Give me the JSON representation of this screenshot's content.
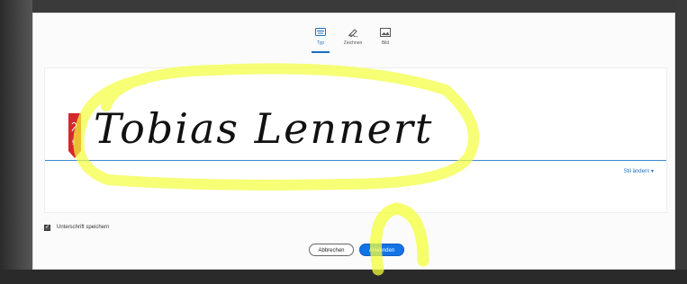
{
  "tabs": [
    {
      "label": "Typ",
      "icon": "keyboard-icon",
      "active": true
    },
    {
      "label": "Zeichnen",
      "icon": "pen-draw-icon",
      "active": false
    },
    {
      "label": "Bild",
      "icon": "image-icon",
      "active": false
    }
  ],
  "signature": {
    "text": "Tobias Lennert",
    "change_style": "Stil ändern ▾"
  },
  "save_signature": {
    "label": "Unterschrift speichern",
    "checked": true
  },
  "buttons": {
    "cancel": "Abbrechen",
    "apply": "Anwenden"
  },
  "colors": {
    "accent": "#1473e6",
    "highlighter": "#f4ff3a",
    "bookmark": "#d7262d"
  }
}
